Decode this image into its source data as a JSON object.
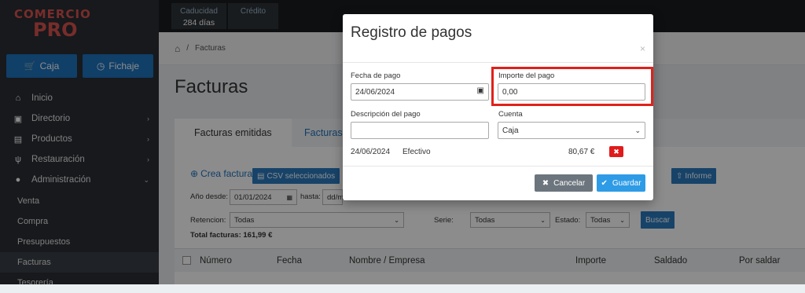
{
  "sidebar": {
    "logo_top": "COMERCIO",
    "logo_bottom": "PRO",
    "buttons": [
      {
        "label": "Caja",
        "icon": "cart-icon"
      },
      {
        "label": "Fichaje",
        "icon": "clock-icon"
      }
    ],
    "menu": [
      {
        "label": "Inicio",
        "icon": "home-icon",
        "chevron": ""
      },
      {
        "label": "Directorio",
        "icon": "address-book-icon",
        "chevron": "›"
      },
      {
        "label": "Productos",
        "icon": "box-icon",
        "chevron": "›"
      },
      {
        "label": "Restauración",
        "icon": "utensils-icon",
        "chevron": "›"
      },
      {
        "label": "Administración",
        "icon": "user-icon",
        "chevron": "⌄"
      }
    ],
    "submenu": [
      {
        "label": "Venta"
      },
      {
        "label": "Compra"
      },
      {
        "label": "Presupuestos"
      },
      {
        "label": "Facturas"
      },
      {
        "label": "Tesorería"
      }
    ]
  },
  "topbar": {
    "caducidad_label": "Caducidad",
    "caducidad_value": "284 días",
    "credito_label": "Crédito"
  },
  "breadcrumb": {
    "current": "Facturas"
  },
  "page": {
    "title": "Facturas",
    "tabs": [
      "Facturas emitidas",
      "Facturas"
    ],
    "toolbar": {
      "create": "Crea factura",
      "csv": "CSV seleccionados",
      "informe": "Informe"
    },
    "filters": {
      "anio_desde_label": "Año desde:",
      "anio_desde_value": "01/01/2024",
      "hasta_label": "hasta:",
      "hasta_value": "dd/m",
      "retencion_label": "Retencion:",
      "retencion_value": "Todas",
      "serie_label": "Serie:",
      "serie_value": "Todas",
      "estado_label": "Estado:",
      "estado_value": "Todas",
      "buscar": "Buscar",
      "total": "Total facturas: 161,99 €"
    },
    "table_headers": [
      "Número",
      "Fecha",
      "Nombre / Empresa",
      "Importe",
      "Saldado",
      "Por saldar"
    ]
  },
  "modal": {
    "title": "Registro de pagos",
    "close": "×",
    "fecha_label": "Fecha de pago",
    "fecha_value": "24/06/2024",
    "importe_label": "Importe del pago",
    "importe_value": "0,00",
    "descripcion_label": "Descripción del pago",
    "descripcion_value": "",
    "cuenta_label": "Cuenta",
    "cuenta_value": "Caja",
    "payment": {
      "date": "24/06/2024",
      "method": "Efectivo",
      "amount": "80,67 €"
    },
    "cancel": "Cancelar",
    "save": "Guardar"
  },
  "colors": {
    "primary": "#1e73be",
    "danger": "#e01b1b",
    "highlight": "#e0211b"
  }
}
